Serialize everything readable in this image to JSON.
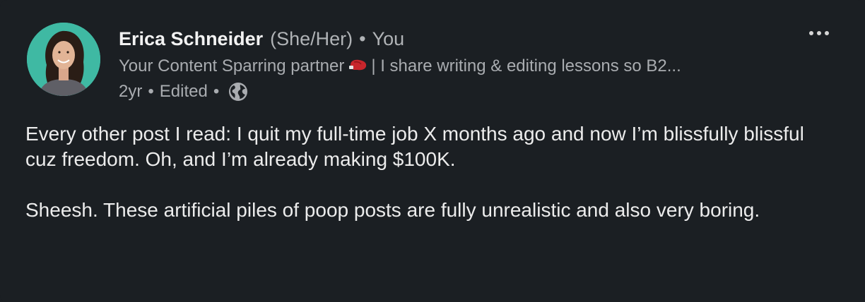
{
  "post": {
    "author": {
      "name": "Erica Schneider",
      "pronouns": "(She/Her)",
      "separator": "•",
      "relationship": "You",
      "headline_before": "Your Content Sparring partner",
      "headline_after": "| I share writing & editing lessons so B2..."
    },
    "meta": {
      "age": "2yr",
      "separator": "•",
      "edited": "Edited",
      "visibility_icon": "globe-icon"
    },
    "menu_icon": "more-horizontal-icon",
    "body": {
      "paragraph_1": "Every other post I read: I quit my full-time job X months ago and now I’m blissfully blissful cuz freedom. Oh, and I’m already making $100K.",
      "paragraph_2": "Sheesh. These artificial piles of poop posts are fully unrealistic and also very boring."
    }
  },
  "colors": {
    "background": "#1b1f23",
    "primary_text": "#ececec",
    "secondary_text": "#a9acb0",
    "avatar_bg": "#3fb9a3"
  }
}
